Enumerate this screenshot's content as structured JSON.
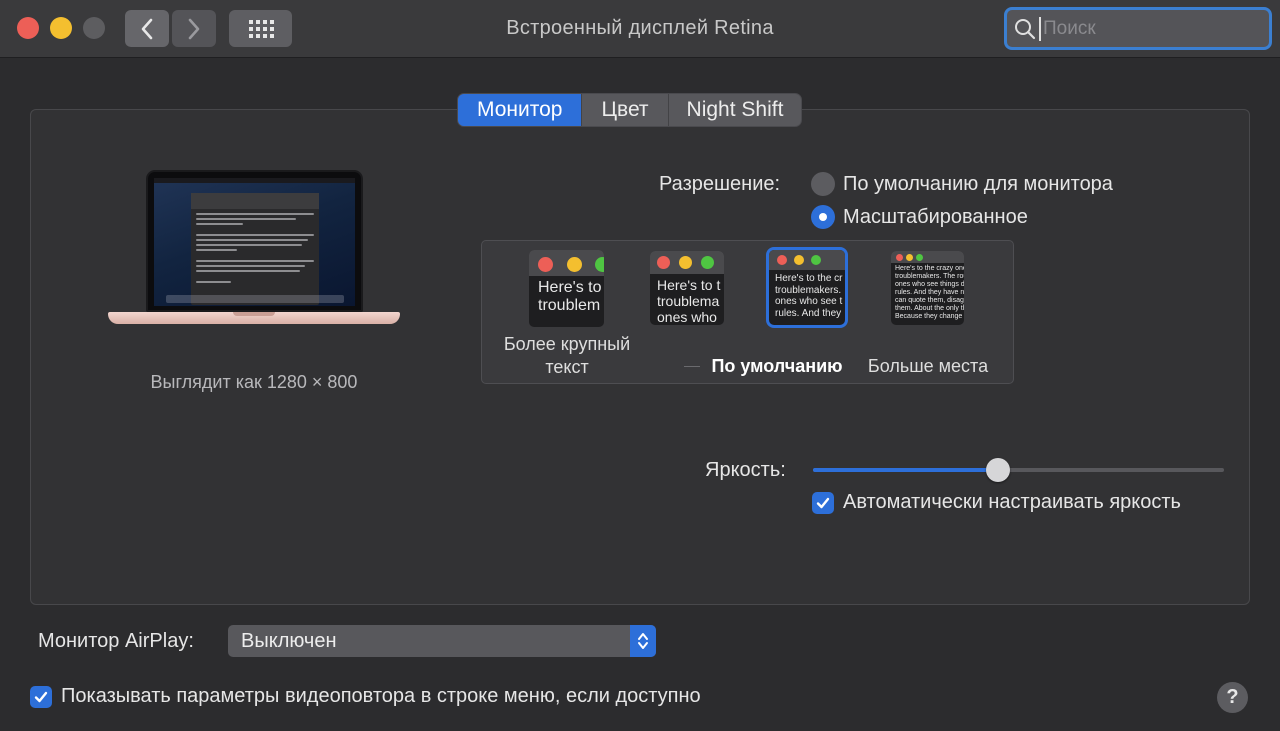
{
  "window": {
    "title": "Встроенный дисплей Retina",
    "search_placeholder": "Поиск"
  },
  "toolbar": {
    "back_icon": "chevron-left-icon",
    "forward_icon": "chevron-right-icon",
    "grid_icon": "grid-icon"
  },
  "tabs": [
    {
      "label": "Монитор",
      "active": true
    },
    {
      "label": "Цвет",
      "active": false
    },
    {
      "label": "Night Shift",
      "active": false
    }
  ],
  "display": {
    "looks_like": "Выглядит как 1280 × 800"
  },
  "resolution": {
    "label": "Разрешение:",
    "options": [
      {
        "label": "По умолчанию для монитора",
        "selected": false
      },
      {
        "label": "Масштабированное",
        "selected": true
      }
    ],
    "scale_options": [
      {
        "label_line1": "Более крупный",
        "label_line2": "текст",
        "preview": [
          "Here's to",
          "troublem"
        ],
        "selected": false
      },
      {
        "label": "",
        "preview": [
          "Here's to t",
          "troublema",
          "ones who"
        ],
        "selected": false
      },
      {
        "label": "По умолчанию",
        "preview": [
          "Here's to the cr",
          "troublemakers.",
          "ones who see t",
          "rules. And they"
        ],
        "selected": true
      },
      {
        "label": "Больше места",
        "preview": [
          "Here's to the crazy one",
          "troublemakers. The rou",
          "ones who see things diff",
          "rules. And they have no",
          "can quote them, disagre",
          "them. About the only th",
          "Because they change th"
        ],
        "selected": false
      }
    ]
  },
  "brightness": {
    "label": "Яркость:",
    "value": 0.45,
    "auto_label": "Автоматически настраивать яркость",
    "auto_checked": true
  },
  "airplay": {
    "label": "Монитор AirPlay:",
    "value": "Выключен"
  },
  "mirroring": {
    "label": "Показывать параметры видеоповтора в строке меню, если доступно",
    "checked": true
  },
  "help": {
    "label": "?"
  },
  "colors": {
    "accent": "#2d6fd9",
    "background": "#2c2c2e",
    "traffic_red": "#ed5f57",
    "traffic_yellow": "#f4bf2f"
  }
}
